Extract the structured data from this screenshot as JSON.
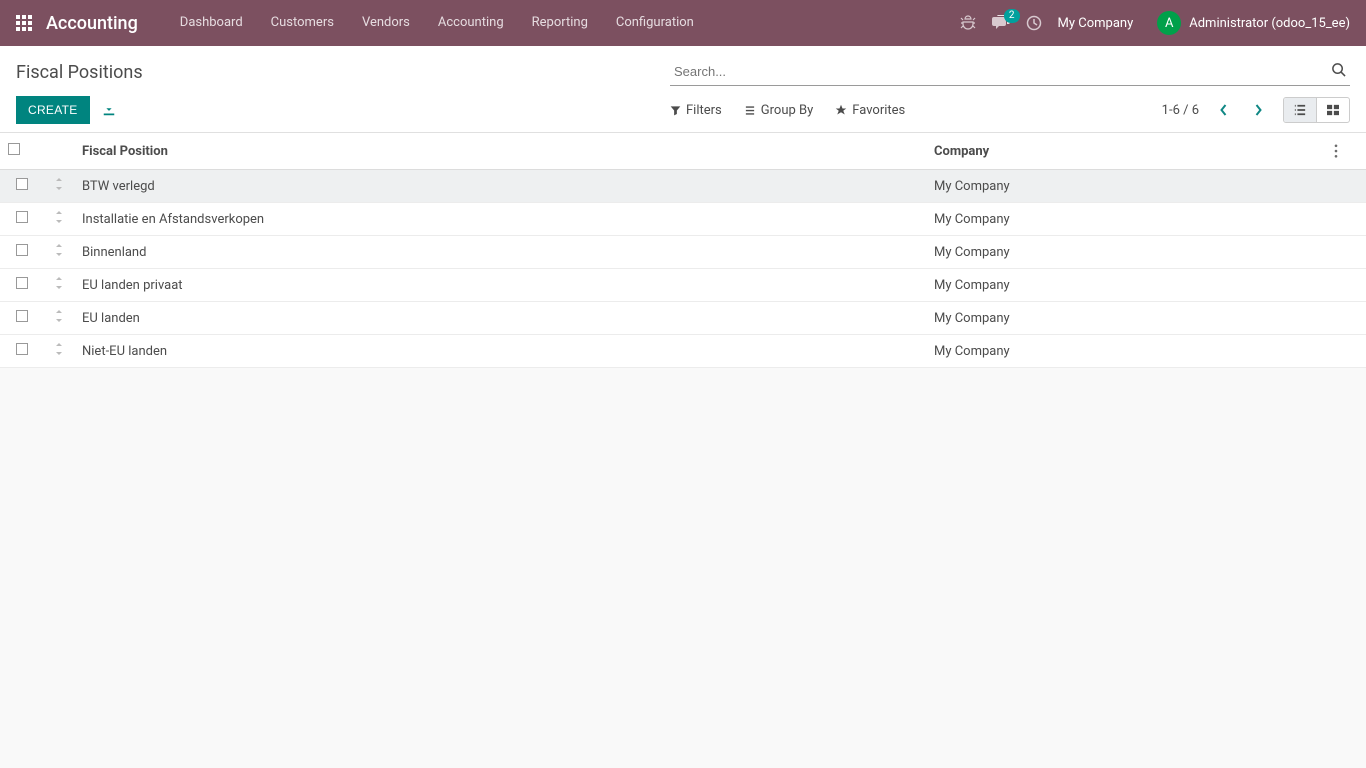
{
  "navbar": {
    "app_name": "Accounting",
    "menu": [
      "Dashboard",
      "Customers",
      "Vendors",
      "Accounting",
      "Reporting",
      "Configuration"
    ],
    "messaging_badge": "2",
    "company": "My Company",
    "avatar_letter": "A",
    "username": "Administrator (odoo_15_ee)"
  },
  "page": {
    "title": "Fiscal Positions",
    "search_placeholder": "Search...",
    "create_label": "Create",
    "filters_label": "Filters",
    "groupby_label": "Group By",
    "favorites_label": "Favorites",
    "pager": "1-6 / 6"
  },
  "table": {
    "headers": {
      "name": "Fiscal Position",
      "company": "Company"
    },
    "rows": [
      {
        "name": "BTW verlegd",
        "company": "My Company"
      },
      {
        "name": "Installatie en Afstandsverkopen",
        "company": "My Company"
      },
      {
        "name": "Binnenland",
        "company": "My Company"
      },
      {
        "name": "EU landen privaat",
        "company": "My Company"
      },
      {
        "name": "EU landen",
        "company": "My Company"
      },
      {
        "name": "Niet-EU landen",
        "company": "My Company"
      }
    ]
  },
  "colors": {
    "primary": "#7c5060",
    "accent": "#00847f",
    "badge": "#00a09d"
  }
}
